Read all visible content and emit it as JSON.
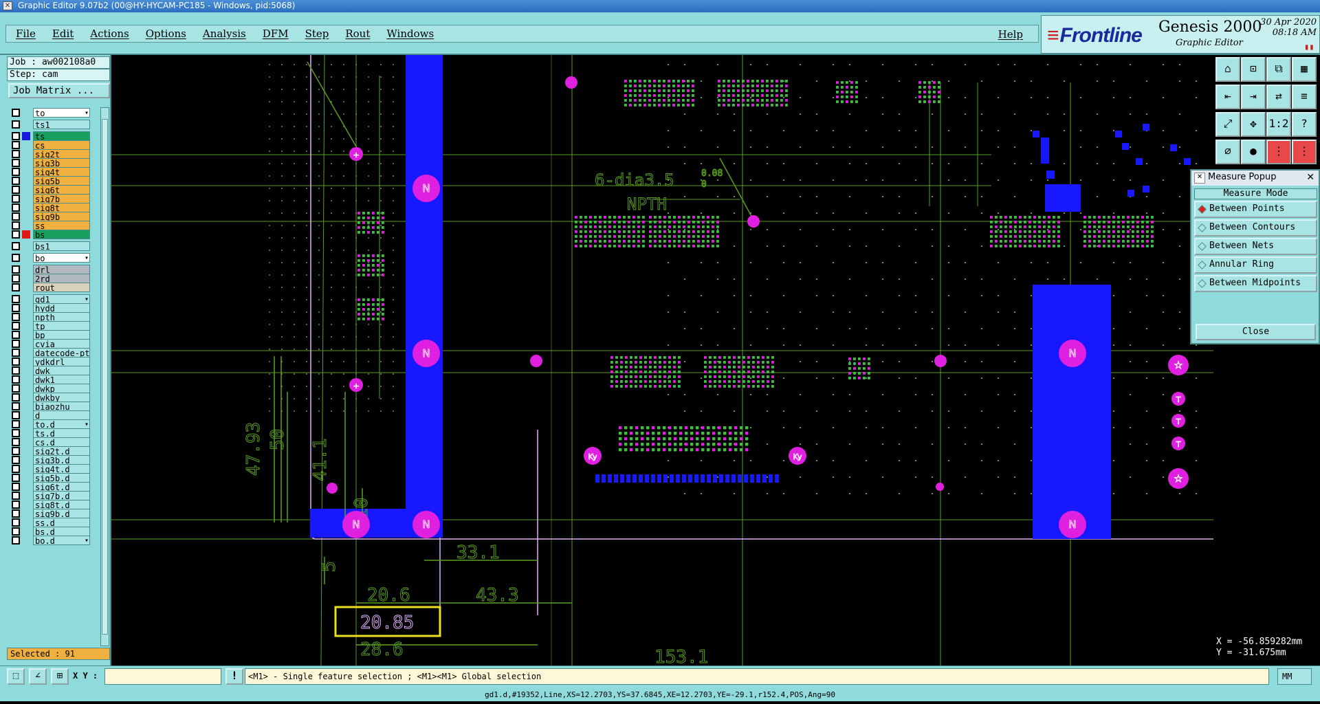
{
  "window": {
    "title": "Graphic Editor 9.07b2 (00@HY-HYCAM-PC185 - Windows, pid:5068)"
  },
  "menu": {
    "items": [
      "File",
      "Edit",
      "Actions",
      "Options",
      "Analysis",
      "DFM",
      "Step",
      "Rout",
      "Windows"
    ],
    "help": "Help"
  },
  "brand": {
    "logo": "Frontline",
    "product": "Genesis 2000",
    "subtitle": "Graphic Editor",
    "date": "30 Apr 2020",
    "time": "08:18 AM"
  },
  "job": {
    "job_label": "Job : aw002108a0",
    "step_label": "Step: cam",
    "matrix_button": "Job Matrix ..."
  },
  "layers": [
    {
      "name": "to",
      "color": "#ffffff",
      "swatch": "",
      "top": true
    },
    {
      "name": "ts1",
      "color": "#a8e4e4",
      "swatch": ""
    },
    {
      "name": "ts",
      "color": "#18a060",
      "swatch": "#1818e0"
    },
    {
      "name": "cs",
      "color": "#f0b040",
      "swatch": ""
    },
    {
      "name": "sig2t",
      "color": "#f0b040",
      "swatch": ""
    },
    {
      "name": "sig3b",
      "color": "#f0b040",
      "swatch": ""
    },
    {
      "name": "sig4t",
      "color": "#f0b040",
      "swatch": ""
    },
    {
      "name": "sig5b",
      "color": "#f0b040",
      "swatch": ""
    },
    {
      "name": "sig6t",
      "color": "#f0b040",
      "swatch": ""
    },
    {
      "name": "sig7b",
      "color": "#f0b040",
      "swatch": ""
    },
    {
      "name": "sig8t",
      "color": "#f0b040",
      "swatch": ""
    },
    {
      "name": "sig9b",
      "color": "#f0b040",
      "swatch": ""
    },
    {
      "name": "ss",
      "color": "#f0b040",
      "swatch": ""
    },
    {
      "name": "bs",
      "color": "#18a060",
      "swatch": "#e01818"
    },
    {
      "name": "bs1",
      "color": "#a8e4e4",
      "swatch": ""
    },
    {
      "name": "bo",
      "color": "#ffffff",
      "swatch": "",
      "top": true
    },
    {
      "name": "drl",
      "color": "#b0b8c0",
      "swatch": ""
    },
    {
      "name": "2rd",
      "color": "#b0b8c0",
      "swatch": ""
    },
    {
      "name": "rout",
      "color": "#d8d0b8",
      "swatch": ""
    },
    {
      "name": "gd1",
      "color": "#a8e4e4",
      "swatch": "",
      "arrow": true
    },
    {
      "name": "hydd",
      "color": "#a8e4e4",
      "swatch": ""
    },
    {
      "name": "npth",
      "color": "#a8e4e4",
      "swatch": ""
    },
    {
      "name": "tp",
      "color": "#a8e4e4",
      "swatch": ""
    },
    {
      "name": "bp",
      "color": "#a8e4e4",
      "swatch": ""
    },
    {
      "name": "cvia",
      "color": "#a8e4e4",
      "swatch": ""
    },
    {
      "name": "datecode-pte",
      "color": "#a8e4e4",
      "swatch": ""
    },
    {
      "name": "ydkdrl",
      "color": "#a8e4e4",
      "swatch": ""
    },
    {
      "name": "dwk",
      "color": "#a8e4e4",
      "swatch": ""
    },
    {
      "name": "dwk1",
      "color": "#a8e4e4",
      "swatch": ""
    },
    {
      "name": "dwkp",
      "color": "#a8e4e4",
      "swatch": ""
    },
    {
      "name": "dwkby",
      "color": "#a8e4e4",
      "swatch": ""
    },
    {
      "name": "biaozhu",
      "color": "#a8e4e4",
      "swatch": ""
    },
    {
      "name": "d",
      "color": "#a8e4e4",
      "swatch": ""
    },
    {
      "name": "to.d",
      "color": "#a8e4e4",
      "swatch": "",
      "arrow": true
    },
    {
      "name": "ts.d",
      "color": "#a8e4e4",
      "swatch": ""
    },
    {
      "name": "cs.d",
      "color": "#a8e4e4",
      "swatch": ""
    },
    {
      "name": "sig2t.d",
      "color": "#a8e4e4",
      "swatch": ""
    },
    {
      "name": "sig3b.d",
      "color": "#a8e4e4",
      "swatch": ""
    },
    {
      "name": "sig4t.d",
      "color": "#a8e4e4",
      "swatch": ""
    },
    {
      "name": "sig5b.d",
      "color": "#a8e4e4",
      "swatch": ""
    },
    {
      "name": "sig6t.d",
      "color": "#a8e4e4",
      "swatch": ""
    },
    {
      "name": "sig7b.d",
      "color": "#a8e4e4",
      "swatch": ""
    },
    {
      "name": "sig8t.d",
      "color": "#a8e4e4",
      "swatch": ""
    },
    {
      "name": "sig9b.d",
      "color": "#a8e4e4",
      "swatch": ""
    },
    {
      "name": "ss.d",
      "color": "#a8e4e4",
      "swatch": ""
    },
    {
      "name": "bs.d",
      "color": "#a8e4e4",
      "swatch": ""
    },
    {
      "name": "bo.d",
      "color": "#a8e4e4",
      "swatch": "",
      "arrow": true
    }
  ],
  "selected": "Selected : 91",
  "canvas": {
    "annotation_main": "6-dia3.5",
    "annotation_tol_plus": "0.08",
    "annotation_tol_minus": "0",
    "annotation_npth": "NPTH",
    "dims": [
      "47.93",
      "50",
      "41.1",
      "10",
      "5",
      "33.1",
      "20.6",
      "43.3",
      "20.85",
      "28.6",
      "153.1"
    ],
    "pad_label": "N",
    "ky_label": "Ky"
  },
  "measure": {
    "title": "Measure Popup",
    "mode_label": "Measure Mode",
    "options": [
      "Between Points",
      "Between Contours",
      "Between Nets",
      "Annular Ring",
      "Between Midpoints"
    ],
    "selected_index": 0,
    "close": "Close"
  },
  "coords": {
    "x": "X = -56.859282mm",
    "y": "Y = -31.675mm"
  },
  "status": {
    "xy_label": "X Y :",
    "xy_value": "",
    "hint": "<M1> - Single feature selection ; <M1><M1> Global selection",
    "units": "MM",
    "feature_info": "gd1.d,#19352,Line,XS=12.2703,YS=37.6845,XE=12.2703,YE=-29.1,r152.4,POS,Ang=90"
  },
  "tool_icons": [
    "home-icon",
    "zoom-icon",
    "copy-icon",
    "help-icon",
    "fit-icon",
    "pan-icon",
    "1to2-icon",
    "question-icon"
  ],
  "colors": {
    "panel": "#8fdada",
    "pad": "#e020e0",
    "copper": "#1818ff",
    "dimension": "#5aa020",
    "highlight": "#e8e020"
  }
}
